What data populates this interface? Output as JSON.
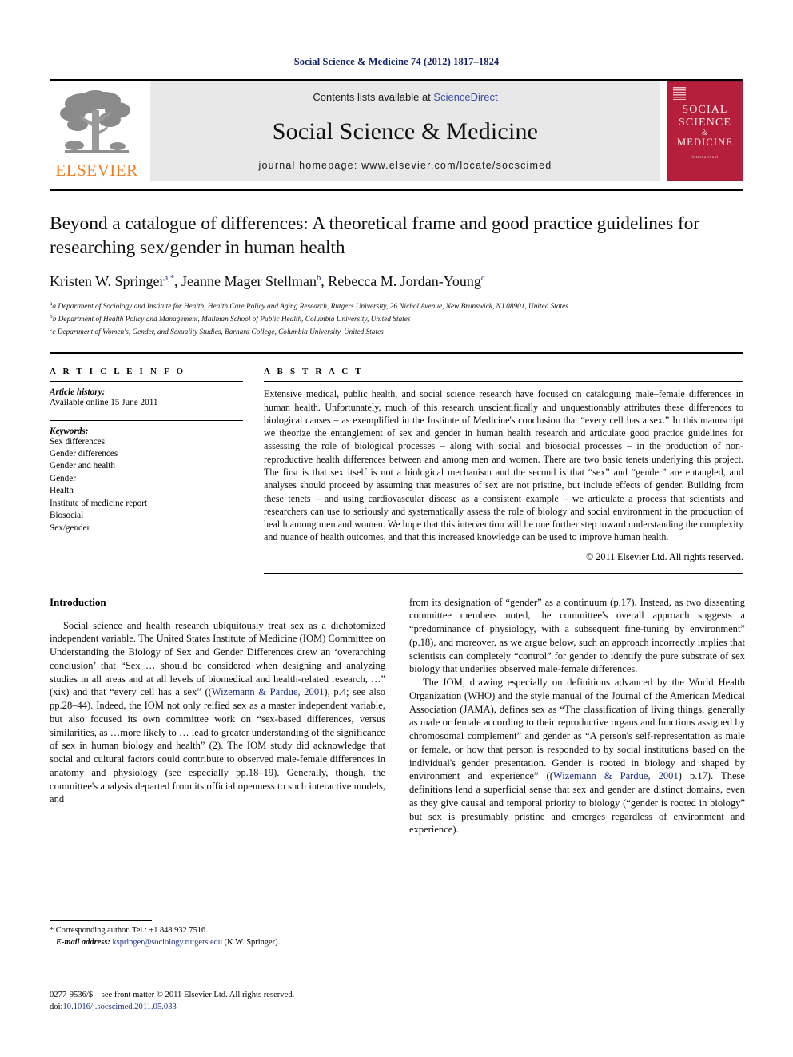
{
  "running_head": "Social Science & Medicine 74 (2012) 1817–1824",
  "masthead": {
    "publisher_name": "ELSEVIER",
    "contents_prefix": "Contents lists available at ",
    "sciencedirect_link": "ScienceDirect",
    "journal_title": "Social Science & Medicine",
    "homepage_line": "journal homepage: www.elsevier.com/locate/socscimed",
    "cover": {
      "line1": "SOCIAL",
      "line2": "SCIENCE",
      "line3": "&",
      "line4": "MEDICINE",
      "subtitle": "international",
      "color": "#b51f3b"
    }
  },
  "article": {
    "title": "Beyond a catalogue of differences: A theoretical frame and good practice guidelines for researching sex/gender in human health",
    "authors_html": "Kristen W. Springer a,*, Jeanne Mager Stellman b, Rebecca M. Jordan-Young c",
    "affiliations": [
      "a Department of Sociology and Institute for Health, Health Care Policy and Aging Research, Rutgers University, 26 Nichol Avenue, New Brunswick, NJ 08901, United States",
      "b Department of Health Policy and Management, Mailman School of Public Health, Columbia University, United States",
      "c Department of Women's, Gender, and Sexuality Studies, Barnard College, Columbia University, United States"
    ]
  },
  "article_info": {
    "heading": "A R T I C L E   I N F O",
    "history_label": "Article history:",
    "history_value": "Available online 15 June 2011",
    "keywords_label": "Keywords:",
    "keywords": [
      "Sex differences",
      "Gender differences",
      "Gender and health",
      "Gender",
      "Health",
      "Institute of medicine report",
      "Biosocial",
      "Sex/gender"
    ]
  },
  "abstract": {
    "heading": "A B S T R A C T",
    "text": "Extensive medical, public health, and social science research have focused on cataloguing male–female differences in human health. Unfortunately, much of this research unscientifically and unquestionably attributes these differences to biological causes – as exemplified in the Institute of Medicine's conclusion that “every cell has a sex.” In this manuscript we theorize the entanglement of sex and gender in human health research and articulate good practice guidelines for assessing the role of biological processes – along with social and biosocial processes – in the production of non-reproductive health differences between and among men and women. There are two basic tenets underlying this project. The first is that sex itself is not a biological mechanism and the second is that “sex” and “gender” are entangled, and analyses should proceed by assuming that measures of sex are not pristine, but include effects of gender. Building from these tenets – and using cardiovascular disease as a consistent example – we articulate a process that scientists and researchers can use to seriously and systematically assess the role of biology and social environment in the production of health among men and women. We hope that this intervention will be one further step toward understanding the complexity and nuance of health outcomes, and that this increased knowledge can be used to improve human health.",
    "copyright": "© 2011 Elsevier Ltd. All rights reserved."
  },
  "body": {
    "section_heading": "Introduction",
    "left_p1_part1": "Social science and health research ubiquitously treat sex as a dichotomized independent variable. The United States Institute of Medicine (IOM) Committee on Understanding the Biology of Sex and Gender Differences drew an ‘overarching conclusion’ that “Sex … should be considered when designing and analyzing studies in all areas and at all levels of biomedical and health-related research, …” (xix) and that “every cell has a sex” ((",
    "left_p1_cite1": "Wizemann & Pardue, 2001",
    "left_p1_part2": "), p.4; see also pp.28–44). Indeed, the IOM not only reified sex as a master independent variable, but also focused its own committee work on “sex-based differences, versus similarities, as …more likely to … lead to greater understanding of the significance of sex in human biology and health” (2). The IOM study did acknowledge that social and cultural factors could contribute to observed male-female differences in anatomy and physiology (see especially pp.18–19). Generally, though, the committee's analysis departed from its official openness to such interactive models, and",
    "right_p1": "from its designation of “gender” as a continuum (p.17). Instead, as two dissenting committee members noted, the committee's overall approach suggests a “predominance of physiology, with a subsequent fine-tuning by environment” (p.18), and moreover, as we argue below, such an approach incorrectly implies that scientists can completely “control” for gender to identify the pure substrate of sex biology that underlies observed male-female differences.",
    "right_p2_part1": "The IOM, drawing especially on definitions advanced by the World Health Organization (WHO) and the style manual of the Journal of the American Medical Association (JAMA), defines sex as “The classification of living things, generally as male or female according to their reproductive organs and functions assigned by chromosomal complement” and gender as “A person's self-representation as male or female, or how that person is responded to by social institutions based on the individual's gender presentation. Gender is rooted in biology and shaped by environment and experience” ((",
    "right_p2_cite": "Wizemann & Pardue, 2001",
    "right_p2_part2": ") p.17). These definitions lend a superficial sense that sex and gender are distinct domains, even as they give causal and temporal priority to biology (“gender is rooted in biology” but sex is presumably pristine and emerges regardless of environment and experience)."
  },
  "footnote": {
    "corresponding": "* Corresponding author. Tel.: +1 848 932 7516.",
    "email_label": "E-mail address:",
    "email": "kspringer@sociology.rutgers.edu",
    "email_suffix": "(K.W. Springer)."
  },
  "footer": {
    "issn_line": "0277-9536/$ – see front matter © 2011 Elsevier Ltd. All rights reserved.",
    "doi_label": "doi:",
    "doi_value": "10.1016/j.socscimed.2011.05.033"
  }
}
